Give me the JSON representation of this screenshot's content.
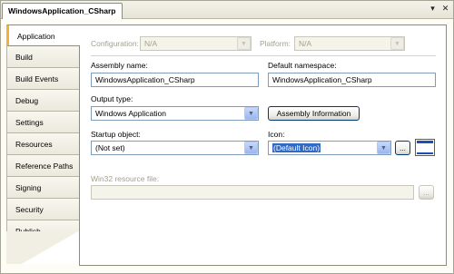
{
  "document_tab": {
    "title": "WindowsApplication_CSharp"
  },
  "window_controls": {
    "dropdown_glyph": "▾",
    "close_glyph": "✕"
  },
  "nav": {
    "items": [
      {
        "label": "Application",
        "active": true
      },
      {
        "label": "Build"
      },
      {
        "label": "Build Events"
      },
      {
        "label": "Debug"
      },
      {
        "label": "Settings"
      },
      {
        "label": "Resources"
      },
      {
        "label": "Reference Paths"
      },
      {
        "label": "Signing"
      },
      {
        "label": "Security"
      },
      {
        "label": "Publish"
      }
    ]
  },
  "config": {
    "configuration_label": "Configuration:",
    "configuration_value": "N/A",
    "platform_label": "Platform:",
    "platform_value": "N/A"
  },
  "form": {
    "assembly_name_label": "Assembly name:",
    "assembly_name_value": "WindowsApplication_CSharp",
    "default_namespace_label": "Default namespace:",
    "default_namespace_value": "WindowsApplication_CSharp",
    "output_type_label": "Output type:",
    "output_type_value": "Windows Application",
    "assembly_info_button": "Assembly Information",
    "startup_object_label": "Startup object:",
    "startup_object_value": "(Not set)",
    "icon_label": "Icon:",
    "icon_value": "(Default Icon)",
    "browse_button": "...",
    "win32_resource_label": "Win32 resource file:",
    "win32_resource_value": "",
    "win32_browse_button": "..."
  },
  "glyphs": {
    "dropdown_arrow": "▼"
  },
  "colors": {
    "active_tab_accent": "#f3b13c",
    "selection_highlight": "#316ac5",
    "field_border": "#7f9db9",
    "disabled_text": "#a3a08f"
  }
}
